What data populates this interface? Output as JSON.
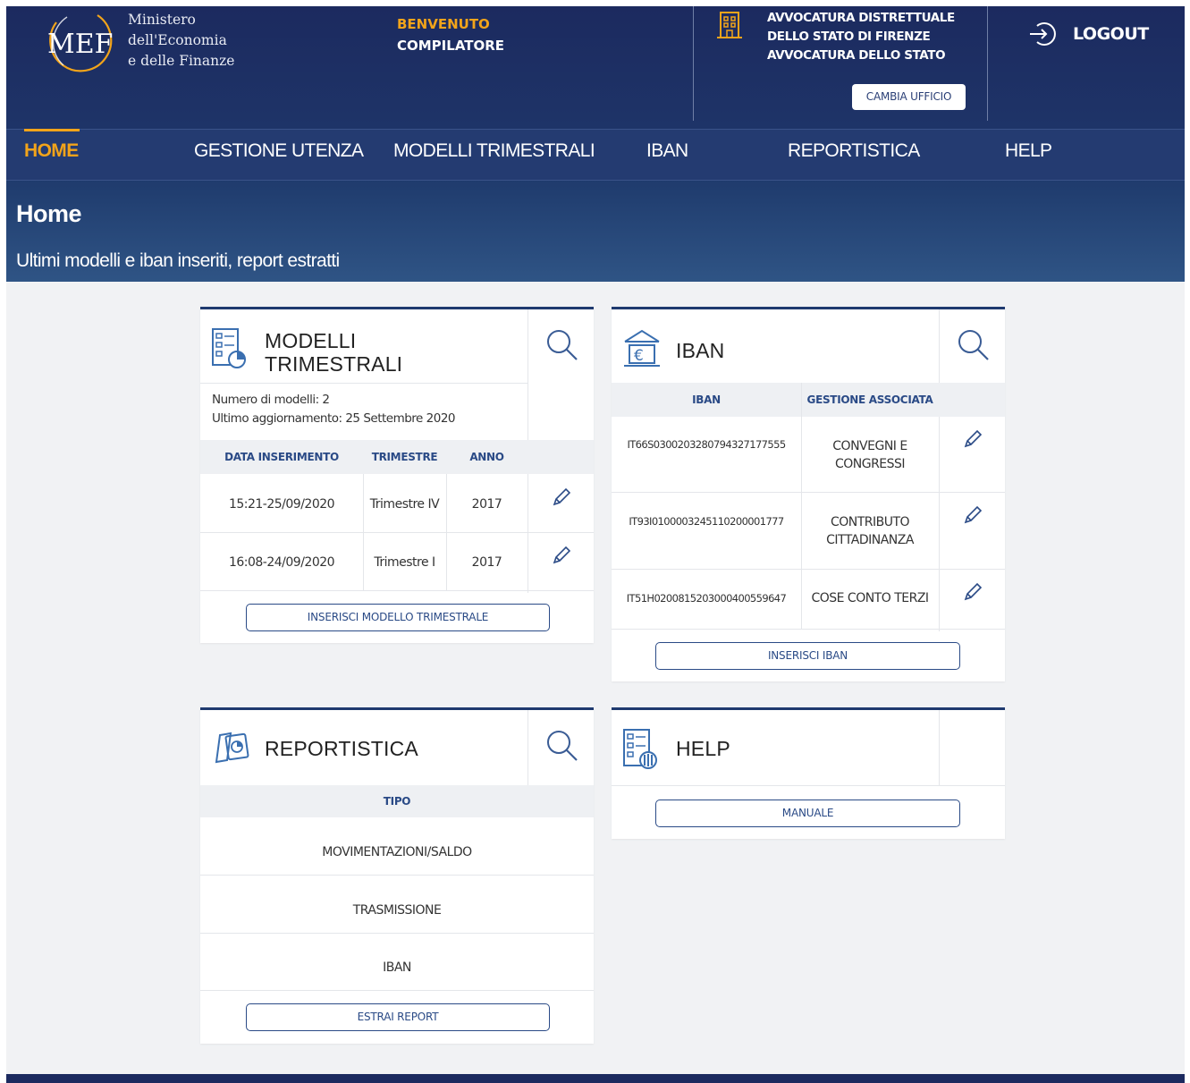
{
  "header": {
    "logo_text": "MEF",
    "ministry_lines": [
      "Ministero",
      "dell'Economia",
      "e delle Finanze"
    ],
    "welcome_line1": "BENVENUTO",
    "welcome_line2": "COMPILATORE",
    "office_name": "AVVOCATURA DISTRETTUALE DELLO STATO DI FIRENZE AVVOCATURA DELLO STATO",
    "change_office_label": "CAMBIA UFFICIO",
    "logout_label": "LOGOUT"
  },
  "nav": {
    "items": [
      {
        "label": "HOME",
        "active": true
      },
      {
        "label": "GESTIONE UTENZA",
        "active": false
      },
      {
        "label": "MODELLI TRIMESTRALI",
        "active": false
      },
      {
        "label": "IBAN",
        "active": false
      },
      {
        "label": "REPORTISTICA",
        "active": false
      },
      {
        "label": "HELP",
        "active": false
      }
    ]
  },
  "page": {
    "title": "Home",
    "subtitle": "Ultimi modelli e iban inseriti, report estratti"
  },
  "modelli": {
    "title_line1": "MODELLI",
    "title_line2": "TRIMESTRALI",
    "count_text": "Numero di modelli: 2",
    "updated_text": "Ultimo aggiornamento: 25 Settembre 2020",
    "columns": [
      "DATA INSERIMENTO",
      "TRIMESTRE",
      "ANNO"
    ],
    "rows": [
      {
        "data": "15:21-25/09/2020",
        "trimestre": "Trimestre IV",
        "anno": "2017"
      },
      {
        "data": "16:08-24/09/2020",
        "trimestre": "Trimestre I",
        "anno": "2017"
      }
    ],
    "button_label": "INSERISCI MODELLO TRIMESTRALE"
  },
  "iban": {
    "title": "IBAN",
    "columns": [
      "IBAN",
      "GESTIONE ASSOCIATA"
    ],
    "rows": [
      {
        "iban": "IT66S0300203280794327177555",
        "gestione": "CONVEGNI E CONGRESSI"
      },
      {
        "iban": "IT93I0100003245110200001777",
        "gestione": "CONTRIBUTO CITTADINANZA"
      },
      {
        "iban": "IT51H0200815203000400559647",
        "gestione": "COSE CONTO TERZI"
      }
    ],
    "button_label": "INSERISCI IBAN"
  },
  "reportistica": {
    "title": "REPORTISTICA",
    "column": "TIPO",
    "rows": [
      "MOVIMENTAZIONI/SALDO",
      "TRASMISSIONE",
      "IBAN"
    ],
    "button_label": "ESTRAI REPORT"
  },
  "help": {
    "title": "HELP",
    "button_label": "MANUALE"
  },
  "colors": {
    "header_navy": "#1c2a5f",
    "nav_blue": "#243b71",
    "accent_orange": "#f2a41a",
    "link_blue": "#2a4a86"
  },
  "icons": [
    "mef-logo",
    "office-building-icon",
    "logout-icon",
    "document-chart-icon",
    "search-icon",
    "bank-euro-icon",
    "edit-pencil-icon",
    "report-icon",
    "help-document-icon"
  ]
}
